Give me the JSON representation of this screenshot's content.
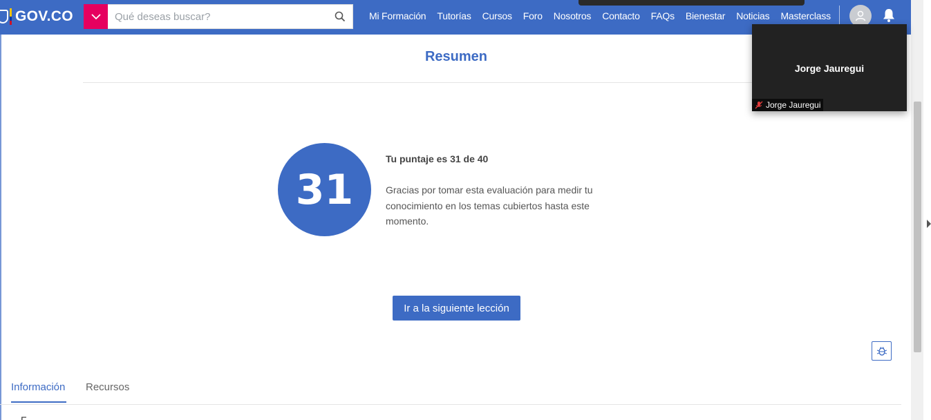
{
  "header": {
    "logo_text": "GOV.CO",
    "search_placeholder": "Qué deseas buscar?",
    "nav": [
      "Mi Formación",
      "Tutorías",
      "Cursos",
      "Foro",
      "Nosotros",
      "Contacto",
      "FAQs",
      "Bienestar",
      "Noticias",
      "Masterclass"
    ]
  },
  "main": {
    "title": "Resumen",
    "score": "31",
    "score_heading": "Tu puntaje es 31 de 40",
    "score_message": "Gracias por tomar esta evaluación para medir tu conocimiento en los temas cubiertos hasta este momento.",
    "next_button": "Ir a la siguiente lección"
  },
  "tabs": {
    "items": [
      "Información",
      "Recursos"
    ],
    "active": "Información",
    "content_first_char": "F"
  },
  "video_call": {
    "participant_center": "Jorge Jauregui",
    "participant_tag": "Jorge Jauregui",
    "mic_status": "muted"
  },
  "colors": {
    "brand_blue": "#3d6bc4",
    "search_dropdown": "#e6005f",
    "video_bg": "#222222"
  }
}
